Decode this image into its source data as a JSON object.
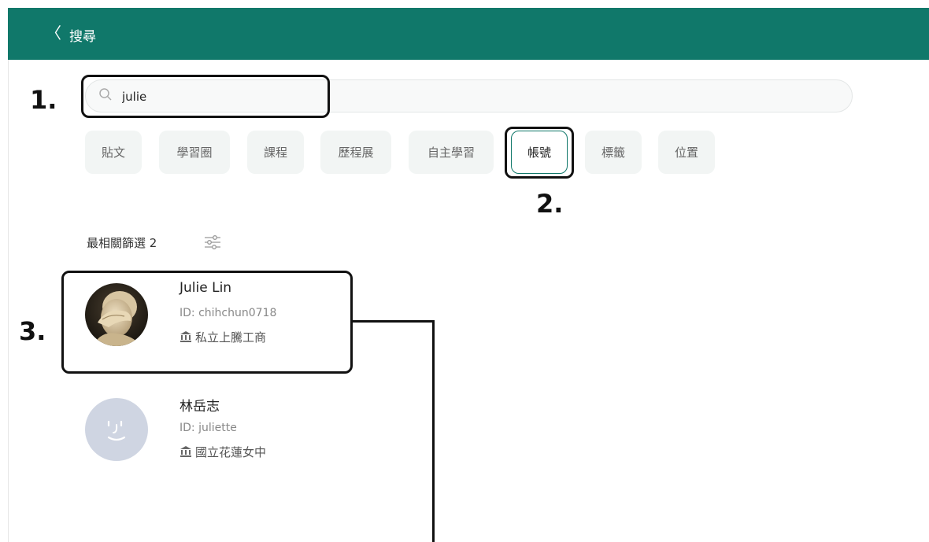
{
  "header": {
    "back_icon": "chevron-left-icon",
    "title": "搜尋",
    "color": "#10786a"
  },
  "search": {
    "value": "julie",
    "placeholder": "",
    "icon": "search-icon"
  },
  "tabs": [
    {
      "label": "貼文",
      "active": false
    },
    {
      "label": "學習圈",
      "active": false
    },
    {
      "label": "課程",
      "active": false
    },
    {
      "label": "歷程展",
      "active": false
    },
    {
      "label": "自主學習",
      "active": false
    },
    {
      "label": "帳號",
      "active": true
    },
    {
      "label": "標籤",
      "active": false
    },
    {
      "label": "位置",
      "active": false
    }
  ],
  "filter": {
    "label": "最相關篩選 2",
    "icon": "filter-sliders-icon"
  },
  "results": [
    {
      "name": "Julie Lin",
      "id": "ID: chihchun0718",
      "school": "私立上騰工商",
      "school_icon": "institution-icon",
      "avatar": "statue-photo"
    },
    {
      "name": "林岳志",
      "id": "ID: juliette",
      "school": "國立花蓮女中",
      "school_icon": "institution-icon",
      "avatar": "default-face-icon"
    }
  ],
  "annotations": [
    "1.",
    "2.",
    "3."
  ]
}
